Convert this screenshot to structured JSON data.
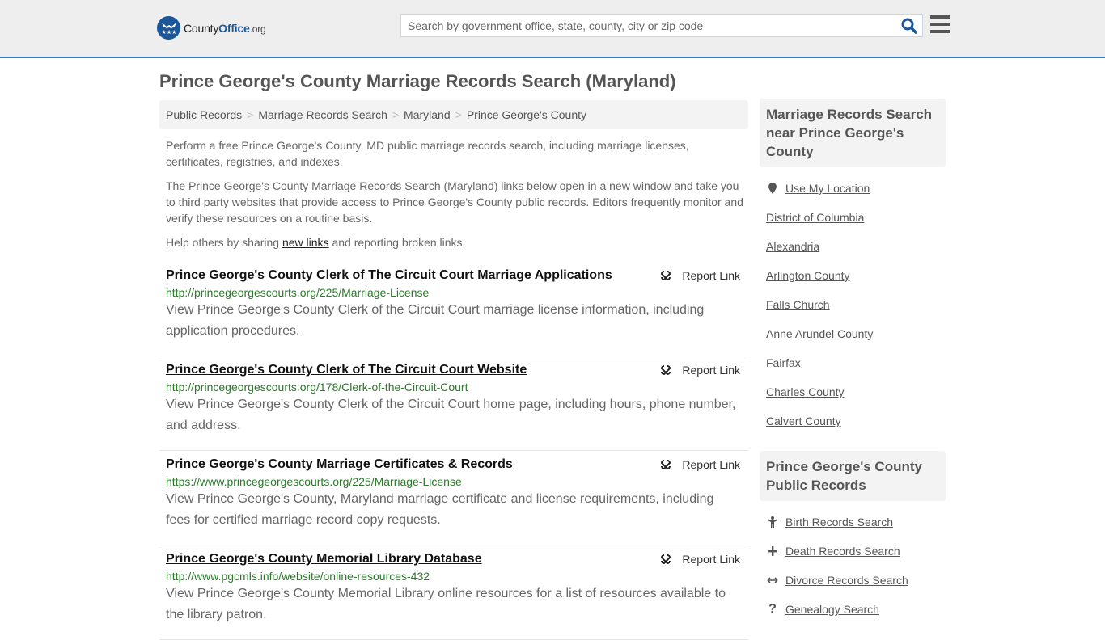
{
  "header": {
    "logo": {
      "brand_a": "County",
      "brand_b": "Office",
      "brand_c": ".org"
    },
    "search": {
      "placeholder": "Search by government office, state, county, city or zip code",
      "value": ""
    },
    "colors": {
      "accent": "#1d5698",
      "bar": "#3a7bb4",
      "url_green": "#2a7a2a"
    }
  },
  "page": {
    "title": "Prince George's County Marriage Records Search (Maryland)",
    "breadcrumb": [
      "Public Records",
      "Marriage Records Search",
      "Maryland",
      "Prince George's County"
    ],
    "intro1": "Perform a free Prince George's County, MD public marriage records search, including marriage licenses, certificates, registries, and indexes.",
    "intro2": "The Prince George's County Marriage Records Search (Maryland) links below open in a new window and take you to third party websites that provide access to Prince George's County public records. Editors frequently monitor and verify these resources on a routine basis.",
    "help_pre": "Help others by sharing ",
    "help_link": "new links",
    "help_post": " and reporting broken links."
  },
  "results": [
    {
      "title": "Prince George's County Clerk of The Circuit Court Marriage Applications",
      "url": "http://princegeorgescourts.org/225/Marriage-License",
      "desc": "View Prince George's County Clerk of the Circuit Court marriage license information, including application procedures.",
      "report": "Report Link"
    },
    {
      "title": "Prince George's County Clerk of The Circuit Court Website",
      "url": "http://princegeorgescourts.org/178/Clerk-of-the-Circuit-Court",
      "desc": "View Prince George's County Clerk of the Circuit Court home page, including hours, phone number, and address.",
      "report": "Report Link"
    },
    {
      "title": "Prince George's County Marriage Certificates & Records",
      "url": "https://www.princegeorgescourts.org/225/Marriage-License",
      "desc": "View Prince George's County, Maryland marriage certificate and license requirements, including fees for certified marriage record copy requests.",
      "report": "Report Link"
    },
    {
      "title": "Prince George's County Memorial Library Database",
      "url": "http://www.pgcmls.info/website/online-resources-432",
      "desc": "View Prince George's County Memorial Library online resources for a list of resources available to the library patron.",
      "report": "Report Link"
    }
  ],
  "sidebar": {
    "nearby_heading": "Marriage Records Search near Prince George's County",
    "use_location": "Use My Location",
    "nearby": [
      "District of Columbia",
      "Alexandria",
      "Arlington County",
      "Falls Church",
      "Anne Arundel County",
      "Fairfax",
      "Charles County",
      "Calvert County"
    ],
    "public_heading": "Prince George's County Public Records",
    "public": [
      {
        "label": "Birth Records Search",
        "icon": "child-icon"
      },
      {
        "label": "Death Records Search",
        "icon": "plus-icon"
      },
      {
        "label": "Divorce Records Search",
        "icon": "arrows-horizontal-icon"
      },
      {
        "label": "Genealogy Search",
        "icon": "question-icon"
      }
    ]
  }
}
